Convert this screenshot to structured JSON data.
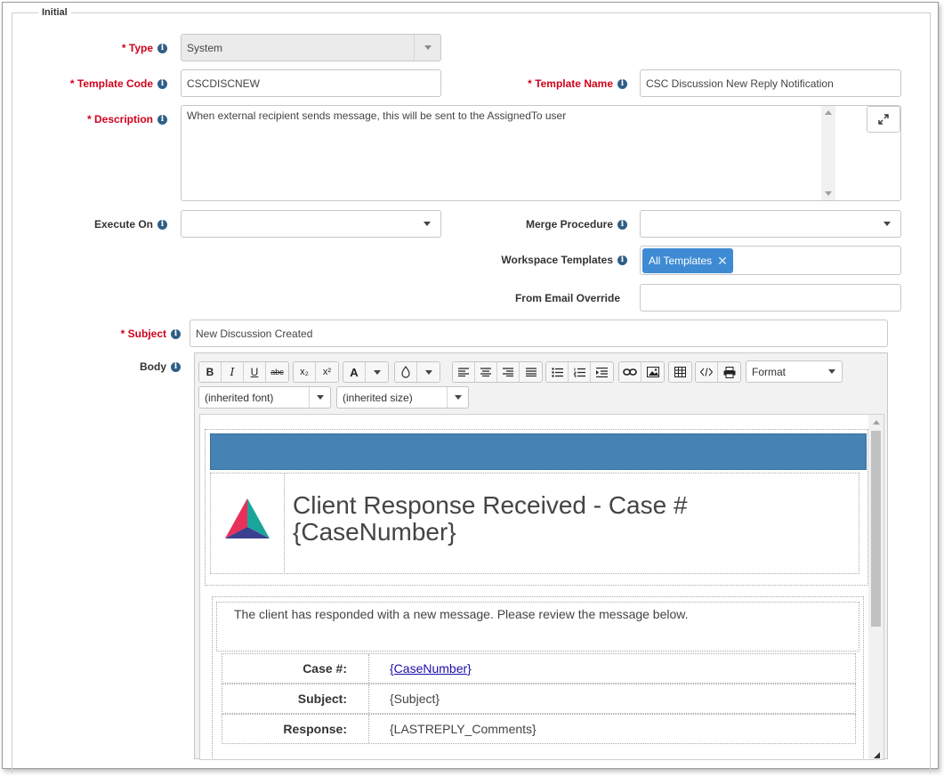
{
  "section": {
    "legend": "Initial"
  },
  "fields": {
    "type": {
      "label": "Type",
      "value": "System"
    },
    "template_code": {
      "label": "Template Code",
      "value": "CSCDISCNEW"
    },
    "template_name": {
      "label": "Template Name",
      "value": "CSC Discussion New Reply Notification"
    },
    "description": {
      "label": "Description",
      "value": "When external recipient sends message, this will be sent to the AssignedTo user"
    },
    "execute_on": {
      "label": "Execute On",
      "value": ""
    },
    "merge_procedure": {
      "label": "Merge Procedure",
      "value": ""
    },
    "workspace_templates": {
      "label": "Workspace Templates",
      "tag": "All Templates",
      "tag_remove": "✕"
    },
    "from_email_override": {
      "label": "From Email Override",
      "value": ""
    },
    "subject": {
      "label": "Subject",
      "value": "New Discussion Created"
    },
    "body": {
      "label": "Body"
    }
  },
  "required_marker": "*",
  "info_glyph": "i",
  "editor": {
    "toolbar": {
      "bold": "B",
      "italic": "I",
      "underline": "U",
      "strike": "abc",
      "subscript": "x₂",
      "superscript": "x²",
      "font_color": "A",
      "format": "Format",
      "font": "(inherited font)",
      "size": "(inherited size)"
    },
    "content": {
      "title": "Client Response Received - Case # {CaseNumber}",
      "message": "The client has responded with a new message. Please review the message below.",
      "rows": [
        {
          "key": "Case #:",
          "value": "{CaseNumber}",
          "link": true
        },
        {
          "key": "Subject:",
          "value": "{Subject}",
          "link": false
        },
        {
          "key": "Response:",
          "value": "{LASTREPLY_Comments}",
          "link": false
        }
      ]
    }
  },
  "colors": {
    "required": "#d0021b",
    "info_icon": "#2f5f86",
    "tag_bg": "#3f8bd3",
    "banner": "#4682b4"
  }
}
